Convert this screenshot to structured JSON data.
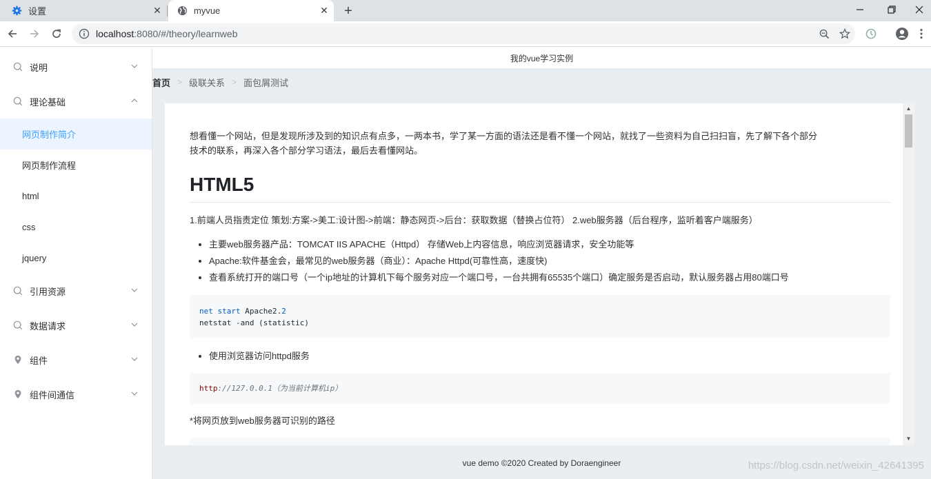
{
  "browser": {
    "tabs": [
      {
        "title": "设置",
        "icon": "gear-icon",
        "active": false
      },
      {
        "title": "myvue",
        "icon": "globe-icon",
        "active": true
      }
    ],
    "url_host": "localhost",
    "url_path": ":8080/#/theory/learnweb",
    "accent": "#1a73e8"
  },
  "page": {
    "header_title": "我的vue学习实例",
    "breadcrumb": [
      "首页",
      "级联关系",
      "面包屑测试"
    ],
    "footer": "vue demo ©2020 Created by Doraengineer",
    "watermark": "https://blog.csdn.net/weixin_42641395"
  },
  "sidebar": {
    "active_color": "#409eff",
    "groups": [
      {
        "label": "说明",
        "icon": "search-icon",
        "expanded": false
      },
      {
        "label": "理论基础",
        "icon": "search-icon",
        "expanded": true,
        "items": [
          "网页制作简介",
          "网页制作流程",
          "html",
          "css",
          "jquery"
        ]
      },
      {
        "label": "引用资源",
        "icon": "search-icon",
        "expanded": false
      },
      {
        "label": "数据请求",
        "icon": "search-icon",
        "expanded": false
      },
      {
        "label": "组件",
        "icon": "location-icon",
        "expanded": false
      },
      {
        "label": "组件间通信",
        "icon": "location-icon",
        "expanded": false
      }
    ],
    "active_item": "网页制作简介"
  },
  "article": {
    "intro_line1": "想看懂一个网站，但是发现所涉及到的知识点有点多，一两本书，学了某一方面的语法还是看不懂一个网站，就找了一些资料为自己扫扫盲，先了解下各个部分",
    "intro_line2": "技术的联系，再深入各个部分学习语法，最后去看懂网站。",
    "heading": "HTML5",
    "para1": "1.前端人员指责定位 策划:方案->美工:设计图->前端：静态网页->后台：获取数据（替换占位符） 2.web服务器（后台程序，监听着客户端服务）",
    "bullets": [
      "主要web服务器产品：TOMCAT IIS APACHE（Httpd） 存储Web上内容信息，响应浏览器请求，安全功能等",
      "Apache:软件基金会，最常见的web服务器（商业）：Apache Httpd(可靠性高，速度快)",
      "查看系统打开的端口号（一个ip地址的计算机下每个服务对应一个端口号，一台共拥有65535个端口）确定服务是否启动，默认服务器占用80端口号"
    ],
    "code1": {
      "kw1": "net",
      "kw2": "start",
      "rest1": " Apache2.",
      "num": "2",
      "line2": "netstat -and (statistic)"
    },
    "bullet2": "使用浏览器访问httpd服务",
    "code2": {
      "scheme": "http",
      "rest": "://127.0.0.1（为当前计算机ip）"
    },
    "para2": "*将网页放到web服务器可识别的路径"
  }
}
